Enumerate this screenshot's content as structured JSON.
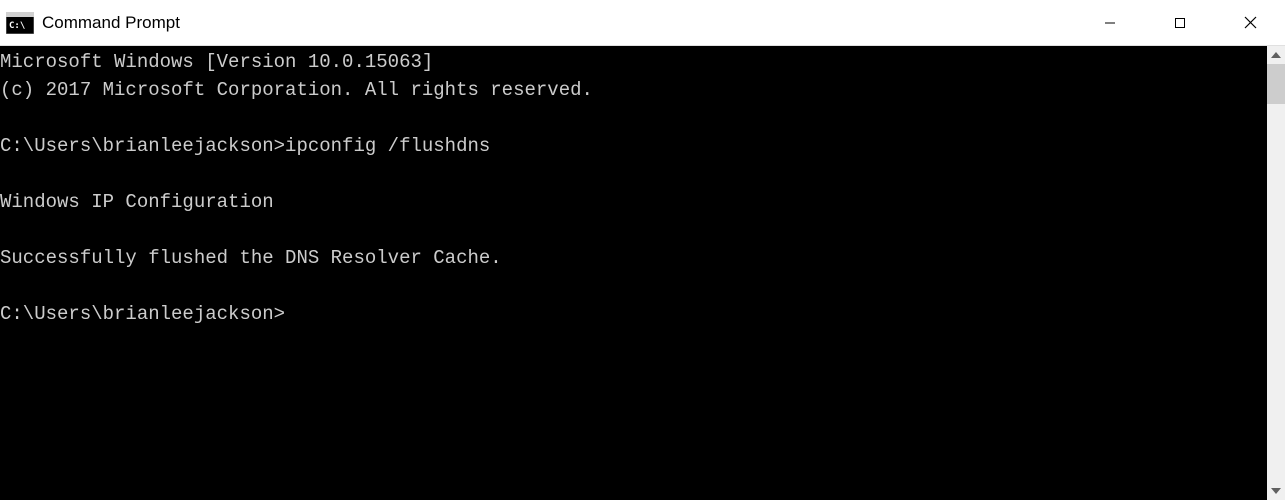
{
  "window": {
    "title": "Command Prompt"
  },
  "terminal": {
    "lines": [
      "Microsoft Windows [Version 10.0.15063]",
      "(c) 2017 Microsoft Corporation. All rights reserved.",
      "",
      "C:\\Users\\brianleejackson>ipconfig /flushdns",
      "",
      "Windows IP Configuration",
      "",
      "Successfully flushed the DNS Resolver Cache.",
      "",
      "C:\\Users\\brianleejackson>"
    ]
  }
}
